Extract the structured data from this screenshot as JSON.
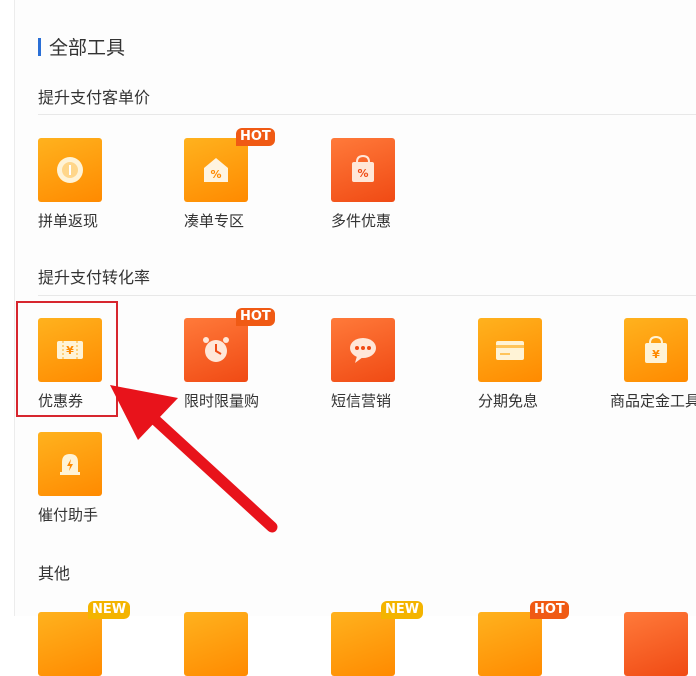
{
  "page": {
    "title": "全部工具"
  },
  "sections": [
    {
      "title": "提升支付客单价",
      "tools": [
        {
          "label": "拼单返现",
          "icon": "coin-icon",
          "badge": ""
        },
        {
          "label": "凑单专区",
          "icon": "percent-house-icon",
          "badge": "HOT"
        },
        {
          "label": "多件优惠",
          "icon": "percent-bag-icon",
          "badge": ""
        }
      ]
    },
    {
      "title": "提升支付转化率",
      "tools": [
        {
          "label": "优惠券",
          "icon": "yuan-coupon-icon",
          "badge": ""
        },
        {
          "label": "限时限量购",
          "icon": "alarm-clock-icon",
          "badge": "HOT"
        },
        {
          "label": "短信营销",
          "icon": "chat-bubble-icon",
          "badge": ""
        },
        {
          "label": "分期免息",
          "icon": "card-icon",
          "badge": ""
        },
        {
          "label": "商品定金工具",
          "icon": "yuan-bag-icon",
          "badge": ""
        },
        {
          "label": "催付助手",
          "icon": "bell-icon",
          "badge": ""
        }
      ]
    },
    {
      "title": "其他",
      "tools": [
        {
          "badge": "NEW"
        },
        {
          "badge": ""
        },
        {
          "badge": "NEW"
        },
        {
          "badge": "HOT"
        },
        {
          "badge": ""
        }
      ]
    }
  ],
  "colors": {
    "accent": "#ff8a00",
    "hot": "#f05a14",
    "new": "#f4b400",
    "highlight": "#d7262e",
    "title_bar": "#2a6fd6"
  }
}
